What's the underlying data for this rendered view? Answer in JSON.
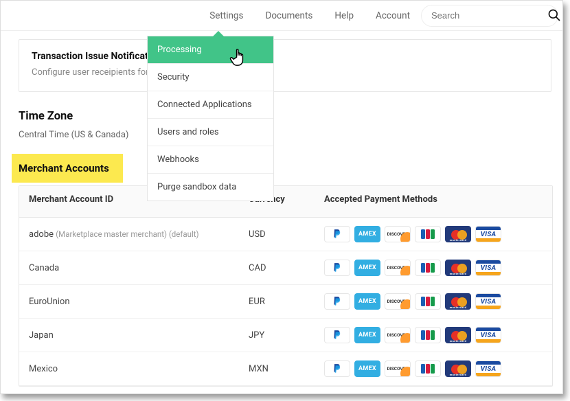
{
  "nav": {
    "items": [
      "Settings",
      "Documents",
      "Help",
      "Account"
    ],
    "search_placeholder": "Search"
  },
  "card": {
    "title": "Transaction Issue Notifications",
    "subtitle": "Configure user receipients for"
  },
  "timezone": {
    "heading": "Time Zone",
    "value": "Central Time (US & Canada)"
  },
  "highlight_label": "Merchant Accounts",
  "dropdown": {
    "items": [
      {
        "label": "Processing",
        "active": true
      },
      {
        "label": "Security",
        "active": false
      },
      {
        "label": "Connected Applications",
        "active": false
      },
      {
        "label": "Users and roles",
        "active": false
      },
      {
        "label": "Webhooks",
        "active": false
      },
      {
        "label": "Purge sandbox data",
        "active": false
      }
    ]
  },
  "table": {
    "headers": [
      "Merchant Account ID",
      "Currency",
      "Accepted Payment Methods"
    ],
    "rows": [
      {
        "id": "adobe",
        "id_note": "(Marketplace master merchant) (default)",
        "currency": "USD"
      },
      {
        "id": "Canada",
        "id_note": "",
        "currency": "CAD"
      },
      {
        "id": "EuroUnion",
        "id_note": "",
        "currency": "EUR"
      },
      {
        "id": "Japan",
        "id_note": "",
        "currency": "JPY"
      },
      {
        "id": "Mexico",
        "id_note": "",
        "currency": "MXN"
      }
    ],
    "badges": [
      "paypal",
      "amex",
      "discover",
      "jcb",
      "mastercard",
      "visa"
    ],
    "badge_labels": {
      "amex": "AMEX",
      "discover": "DISCOVER",
      "jcb": "JCB",
      "mastercard": "mastercard",
      "visa": "VISA"
    }
  }
}
